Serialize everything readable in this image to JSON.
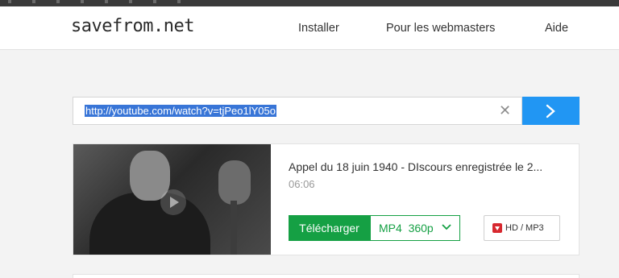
{
  "header": {
    "logo": "savefrom.net",
    "nav": [
      "Installer",
      "Pour les webmasters",
      "Aide"
    ]
  },
  "search": {
    "url": "http://youtube.com/watch?v=tjPeo1lY05o",
    "clear_icon": "close-icon",
    "submit_icon": "chevron-right-icon"
  },
  "result": {
    "title": "Appel du 18 juin 1940 - DIscours enregistrée le 2...",
    "duration": "06:06",
    "download_label": "Télécharger",
    "format_label": "MP4  360p",
    "hd_label": "HD / MP3"
  },
  "colors": {
    "accent_blue": "#2196f3",
    "download_green": "#15a044",
    "hd_red": "#d7282f"
  }
}
